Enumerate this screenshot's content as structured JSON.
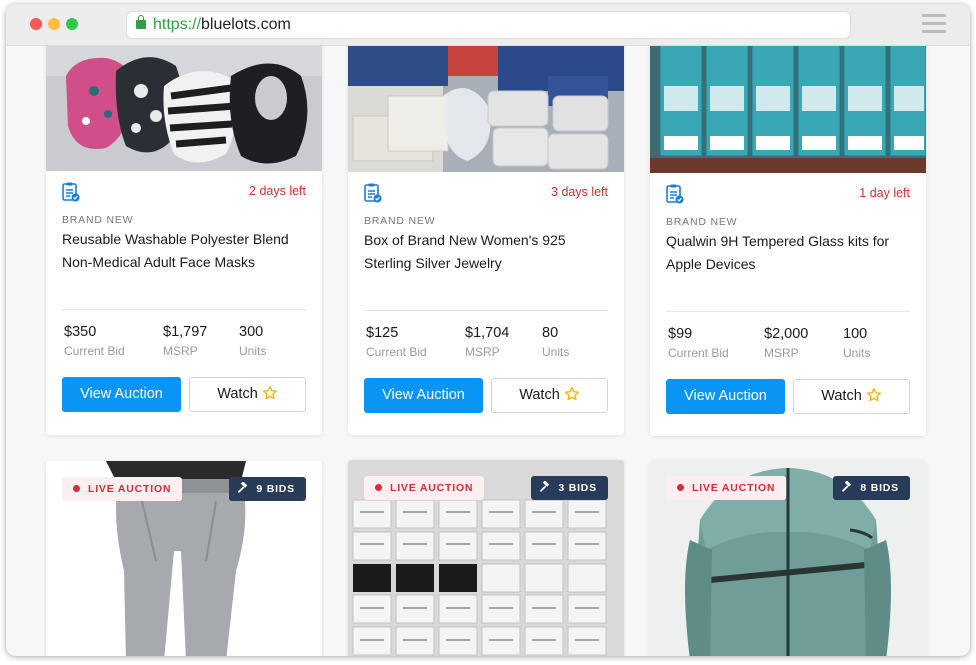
{
  "browser": {
    "url_scheme": "https://",
    "url_host": "bluelots.com"
  },
  "top_cards": [
    {
      "days_left": "2 days left",
      "condition": "BRAND NEW",
      "title": "Reusable Washable Polyester Blend Non-Medical Adult Face Masks",
      "current_bid": "$350",
      "current_bid_label": "Current Bid",
      "msrp": "$1,797",
      "msrp_label": "MSRP",
      "units": "300",
      "units_label": "Units",
      "view_label": "View Auction",
      "watch_label": "Watch"
    },
    {
      "days_left": "3 days left",
      "condition": "BRAND NEW",
      "title": "Box of Brand New Women's 925 Sterling Silver Jewelry",
      "current_bid": "$125",
      "current_bid_label": "Current Bid",
      "msrp": "$1,704",
      "msrp_label": "MSRP",
      "units": "80",
      "units_label": "Units",
      "view_label": "View Auction",
      "watch_label": "Watch"
    },
    {
      "days_left": "1 day left",
      "condition": "BRAND NEW",
      "title": "Qualwin 9H Tempered Glass kits for Apple Devices",
      "current_bid": "$99",
      "current_bid_label": "Current Bid",
      "msrp": "$2,000",
      "msrp_label": "MSRP",
      "units": "100",
      "units_label": "Units",
      "view_label": "View Auction",
      "watch_label": "Watch"
    }
  ],
  "bottom_cards": [
    {
      "badge": "LIVE AUCTION",
      "bids": "9 BIDS"
    },
    {
      "badge": "LIVE AUCTION",
      "bids": "3 BIDS"
    },
    {
      "badge": "LIVE AUCTION",
      "bids": "8 BIDS"
    }
  ],
  "colors": {
    "primary": "#0a95f5",
    "deadline": "#d32f2f",
    "live_badge_bg": "#fdeef0",
    "live_badge_text": "#d42d3c",
    "bids_badge_bg": "#283c5a",
    "star": "#f4b400"
  },
  "icons": {
    "condition": "clipboard-check-icon",
    "watch": "star-icon",
    "bids": "gavel-icon",
    "menu": "hamburger-menu-icon",
    "secure": "lock-icon"
  }
}
